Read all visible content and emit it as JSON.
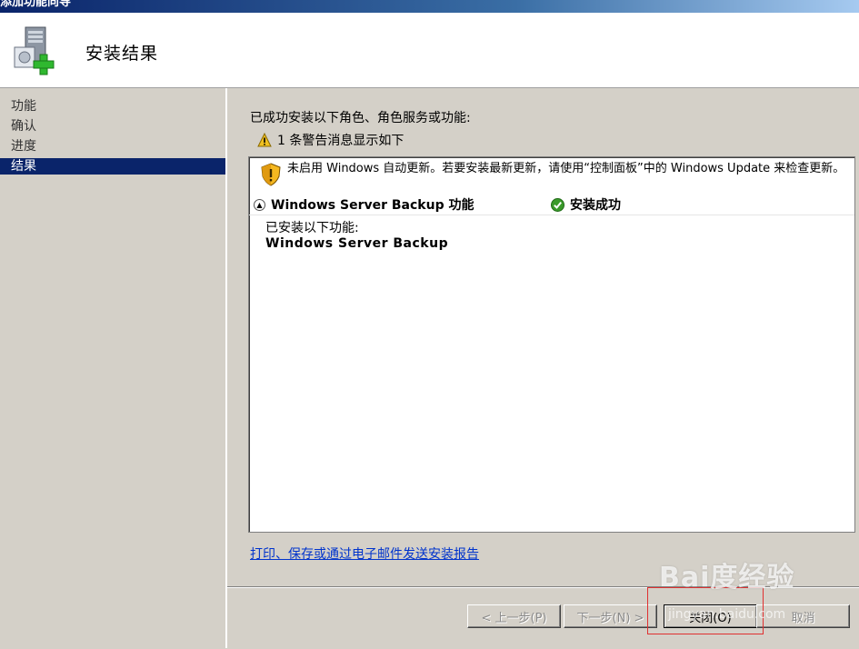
{
  "window": {
    "title": "添加功能向导"
  },
  "header": {
    "title": "安装结果"
  },
  "sidebar": {
    "steps": [
      {
        "label": "功能"
      },
      {
        "label": "确认"
      },
      {
        "label": "进度"
      },
      {
        "label": "结果"
      }
    ],
    "active_index": 3
  },
  "main": {
    "intro": "已成功安装以下角色、角色服务或功能:",
    "warning_summary": "1 条警告消息显示如下",
    "notice": "未启用 Windows 自动更新。若要安装最新更新，请使用“控制面板”中的 Windows Update 来检查更新。",
    "feature": {
      "name": "Windows Server Backup 功能",
      "status": "安装成功",
      "installed_label": "已安装以下功能:",
      "installed_item": "Windows Server Backup"
    },
    "report_link": "打印、保存或通过电子邮件发送安装报告"
  },
  "footer": {
    "back": "< 上一步(P)",
    "next": "下一步(N) >",
    "close": "关闭(O)",
    "cancel": "取消"
  },
  "watermark": {
    "logo": "Bai度经验",
    "url": "jingyan.baidu.com"
  },
  "colors": {
    "accent": "#0a246a",
    "link": "#0033cc",
    "success": "#3a9a2a",
    "warning": "#f0c020"
  }
}
